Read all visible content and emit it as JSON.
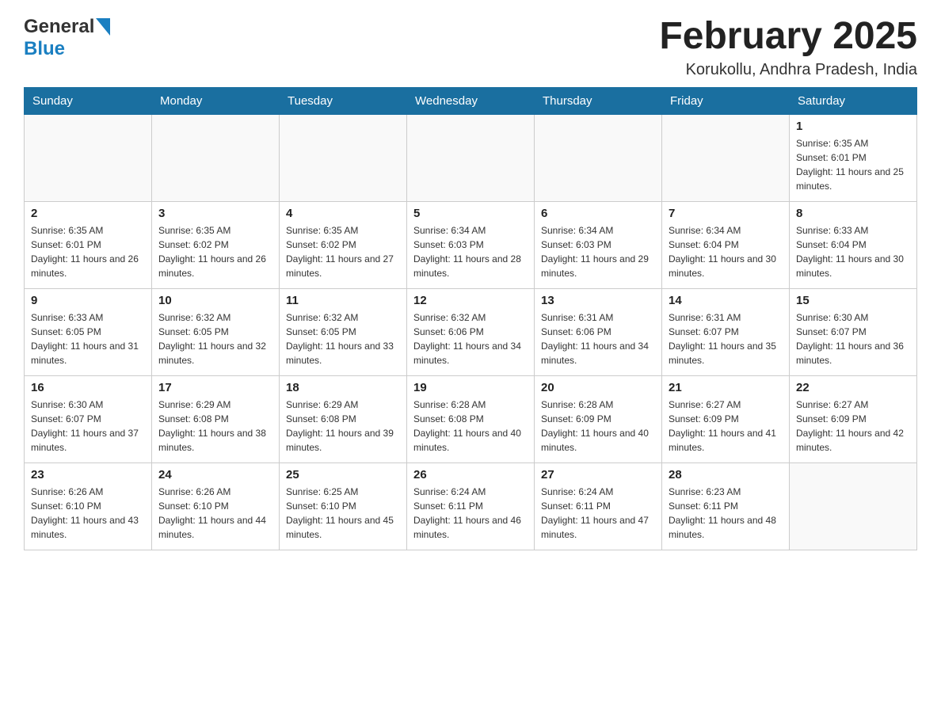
{
  "header": {
    "logo_general": "General",
    "logo_blue": "Blue",
    "month_title": "February 2025",
    "location": "Korukollu, Andhra Pradesh, India"
  },
  "days_of_week": [
    "Sunday",
    "Monday",
    "Tuesday",
    "Wednesday",
    "Thursday",
    "Friday",
    "Saturday"
  ],
  "weeks": [
    {
      "days": [
        {
          "date": "",
          "sunrise": "",
          "sunset": "",
          "daylight": ""
        },
        {
          "date": "",
          "sunrise": "",
          "sunset": "",
          "daylight": ""
        },
        {
          "date": "",
          "sunrise": "",
          "sunset": "",
          "daylight": ""
        },
        {
          "date": "",
          "sunrise": "",
          "sunset": "",
          "daylight": ""
        },
        {
          "date": "",
          "sunrise": "",
          "sunset": "",
          "daylight": ""
        },
        {
          "date": "",
          "sunrise": "",
          "sunset": "",
          "daylight": ""
        },
        {
          "date": "1",
          "sunrise": "Sunrise: 6:35 AM",
          "sunset": "Sunset: 6:01 PM",
          "daylight": "Daylight: 11 hours and 25 minutes."
        }
      ]
    },
    {
      "days": [
        {
          "date": "2",
          "sunrise": "Sunrise: 6:35 AM",
          "sunset": "Sunset: 6:01 PM",
          "daylight": "Daylight: 11 hours and 26 minutes."
        },
        {
          "date": "3",
          "sunrise": "Sunrise: 6:35 AM",
          "sunset": "Sunset: 6:02 PM",
          "daylight": "Daylight: 11 hours and 26 minutes."
        },
        {
          "date": "4",
          "sunrise": "Sunrise: 6:35 AM",
          "sunset": "Sunset: 6:02 PM",
          "daylight": "Daylight: 11 hours and 27 minutes."
        },
        {
          "date": "5",
          "sunrise": "Sunrise: 6:34 AM",
          "sunset": "Sunset: 6:03 PM",
          "daylight": "Daylight: 11 hours and 28 minutes."
        },
        {
          "date": "6",
          "sunrise": "Sunrise: 6:34 AM",
          "sunset": "Sunset: 6:03 PM",
          "daylight": "Daylight: 11 hours and 29 minutes."
        },
        {
          "date": "7",
          "sunrise": "Sunrise: 6:34 AM",
          "sunset": "Sunset: 6:04 PM",
          "daylight": "Daylight: 11 hours and 30 minutes."
        },
        {
          "date": "8",
          "sunrise": "Sunrise: 6:33 AM",
          "sunset": "Sunset: 6:04 PM",
          "daylight": "Daylight: 11 hours and 30 minutes."
        }
      ]
    },
    {
      "days": [
        {
          "date": "9",
          "sunrise": "Sunrise: 6:33 AM",
          "sunset": "Sunset: 6:05 PM",
          "daylight": "Daylight: 11 hours and 31 minutes."
        },
        {
          "date": "10",
          "sunrise": "Sunrise: 6:32 AM",
          "sunset": "Sunset: 6:05 PM",
          "daylight": "Daylight: 11 hours and 32 minutes."
        },
        {
          "date": "11",
          "sunrise": "Sunrise: 6:32 AM",
          "sunset": "Sunset: 6:05 PM",
          "daylight": "Daylight: 11 hours and 33 minutes."
        },
        {
          "date": "12",
          "sunrise": "Sunrise: 6:32 AM",
          "sunset": "Sunset: 6:06 PM",
          "daylight": "Daylight: 11 hours and 34 minutes."
        },
        {
          "date": "13",
          "sunrise": "Sunrise: 6:31 AM",
          "sunset": "Sunset: 6:06 PM",
          "daylight": "Daylight: 11 hours and 34 minutes."
        },
        {
          "date": "14",
          "sunrise": "Sunrise: 6:31 AM",
          "sunset": "Sunset: 6:07 PM",
          "daylight": "Daylight: 11 hours and 35 minutes."
        },
        {
          "date": "15",
          "sunrise": "Sunrise: 6:30 AM",
          "sunset": "Sunset: 6:07 PM",
          "daylight": "Daylight: 11 hours and 36 minutes."
        }
      ]
    },
    {
      "days": [
        {
          "date": "16",
          "sunrise": "Sunrise: 6:30 AM",
          "sunset": "Sunset: 6:07 PM",
          "daylight": "Daylight: 11 hours and 37 minutes."
        },
        {
          "date": "17",
          "sunrise": "Sunrise: 6:29 AM",
          "sunset": "Sunset: 6:08 PM",
          "daylight": "Daylight: 11 hours and 38 minutes."
        },
        {
          "date": "18",
          "sunrise": "Sunrise: 6:29 AM",
          "sunset": "Sunset: 6:08 PM",
          "daylight": "Daylight: 11 hours and 39 minutes."
        },
        {
          "date": "19",
          "sunrise": "Sunrise: 6:28 AM",
          "sunset": "Sunset: 6:08 PM",
          "daylight": "Daylight: 11 hours and 40 minutes."
        },
        {
          "date": "20",
          "sunrise": "Sunrise: 6:28 AM",
          "sunset": "Sunset: 6:09 PM",
          "daylight": "Daylight: 11 hours and 40 minutes."
        },
        {
          "date": "21",
          "sunrise": "Sunrise: 6:27 AM",
          "sunset": "Sunset: 6:09 PM",
          "daylight": "Daylight: 11 hours and 41 minutes."
        },
        {
          "date": "22",
          "sunrise": "Sunrise: 6:27 AM",
          "sunset": "Sunset: 6:09 PM",
          "daylight": "Daylight: 11 hours and 42 minutes."
        }
      ]
    },
    {
      "days": [
        {
          "date": "23",
          "sunrise": "Sunrise: 6:26 AM",
          "sunset": "Sunset: 6:10 PM",
          "daylight": "Daylight: 11 hours and 43 minutes."
        },
        {
          "date": "24",
          "sunrise": "Sunrise: 6:26 AM",
          "sunset": "Sunset: 6:10 PM",
          "daylight": "Daylight: 11 hours and 44 minutes."
        },
        {
          "date": "25",
          "sunrise": "Sunrise: 6:25 AM",
          "sunset": "Sunset: 6:10 PM",
          "daylight": "Daylight: 11 hours and 45 minutes."
        },
        {
          "date": "26",
          "sunrise": "Sunrise: 6:24 AM",
          "sunset": "Sunset: 6:11 PM",
          "daylight": "Daylight: 11 hours and 46 minutes."
        },
        {
          "date": "27",
          "sunrise": "Sunrise: 6:24 AM",
          "sunset": "Sunset: 6:11 PM",
          "daylight": "Daylight: 11 hours and 47 minutes."
        },
        {
          "date": "28",
          "sunrise": "Sunrise: 6:23 AM",
          "sunset": "Sunset: 6:11 PM",
          "daylight": "Daylight: 11 hours and 48 minutes."
        },
        {
          "date": "",
          "sunrise": "",
          "sunset": "",
          "daylight": ""
        }
      ]
    }
  ]
}
